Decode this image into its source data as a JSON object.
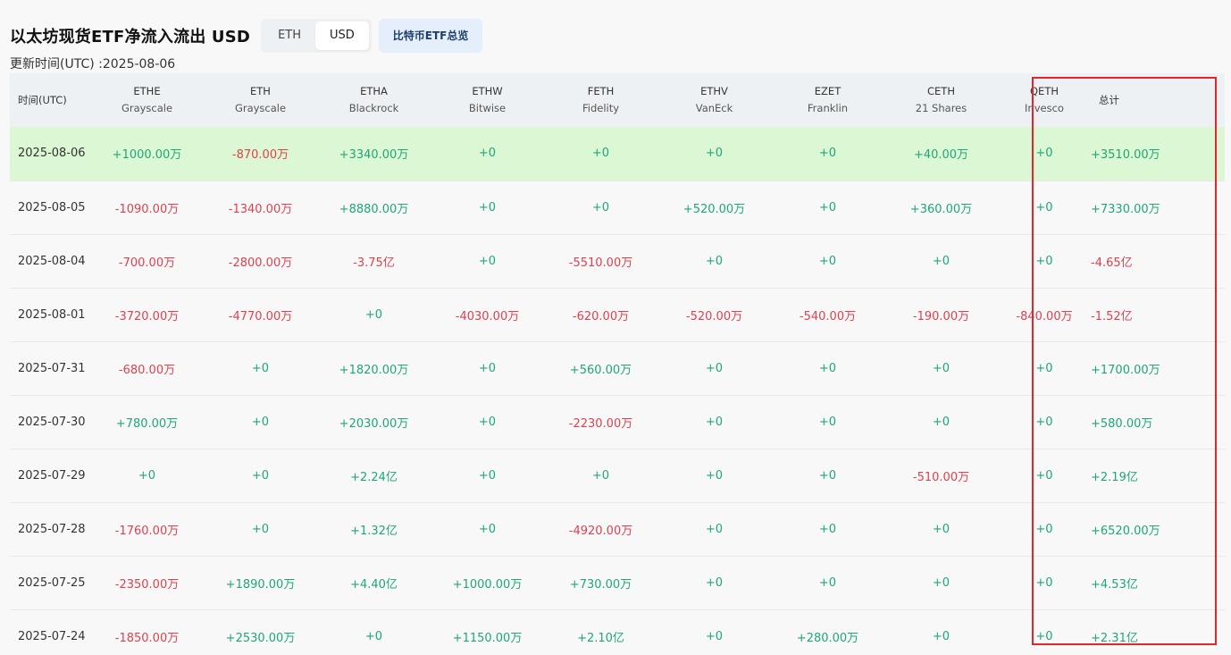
{
  "title": "以太坊现货ETF净流入流出 USD",
  "currency_toggle": {
    "options": [
      "ETH",
      "USD"
    ],
    "selected": "USD"
  },
  "btc_overview_label": "比特币ETF总览",
  "updated": "更新时间(UTC) :2025-08-06",
  "table": {
    "time_header": "时间(UTC)",
    "total_header": "总计",
    "columns": [
      {
        "ticker": "ETHE",
        "fund": "Grayscale"
      },
      {
        "ticker": "ETH",
        "fund": "Grayscale"
      },
      {
        "ticker": "ETHA",
        "fund": "Blackrock"
      },
      {
        "ticker": "ETHW",
        "fund": "Bitwise"
      },
      {
        "ticker": "FETH",
        "fund": "Fidelity"
      },
      {
        "ticker": "ETHV",
        "fund": "VanEck"
      },
      {
        "ticker": "EZET",
        "fund": "Franklin"
      },
      {
        "ticker": "CETH",
        "fund": "21 Shares"
      },
      {
        "ticker": "QETH",
        "fund": "Invesco"
      }
    ],
    "rows": [
      {
        "date": "2025-08-06",
        "highlight": true,
        "values": [
          "+1000.00万",
          "-870.00万",
          "+3340.00万",
          "+0",
          "+0",
          "+0",
          "+0",
          "+40.00万",
          "+0"
        ],
        "total": "+3510.00万"
      },
      {
        "date": "2025-08-05",
        "highlight": false,
        "values": [
          "-1090.00万",
          "-1340.00万",
          "+8880.00万",
          "+0",
          "+0",
          "+520.00万",
          "+0",
          "+360.00万",
          "+0"
        ],
        "total": "+7330.00万"
      },
      {
        "date": "2025-08-04",
        "highlight": false,
        "values": [
          "-700.00万",
          "-2800.00万",
          "-3.75亿",
          "+0",
          "-5510.00万",
          "+0",
          "+0",
          "+0",
          "+0"
        ],
        "total": "-4.65亿"
      },
      {
        "date": "2025-08-01",
        "highlight": false,
        "values": [
          "-3720.00万",
          "-4770.00万",
          "+0",
          "-4030.00万",
          "-620.00万",
          "-520.00万",
          "-540.00万",
          "-190.00万",
          "-840.00万"
        ],
        "total": "-1.52亿"
      },
      {
        "date": "2025-07-31",
        "highlight": false,
        "values": [
          "-680.00万",
          "+0",
          "+1820.00万",
          "+0",
          "+560.00万",
          "+0",
          "+0",
          "+0",
          "+0"
        ],
        "total": "+1700.00万"
      },
      {
        "date": "2025-07-30",
        "highlight": false,
        "values": [
          "+780.00万",
          "+0",
          "+2030.00万",
          "+0",
          "-2230.00万",
          "+0",
          "+0",
          "+0",
          "+0"
        ],
        "total": "+580.00万"
      },
      {
        "date": "2025-07-29",
        "highlight": false,
        "values": [
          "+0",
          "+0",
          "+2.24亿",
          "+0",
          "+0",
          "+0",
          "+0",
          "-510.00万",
          "+0"
        ],
        "total": "+2.19亿"
      },
      {
        "date": "2025-07-28",
        "highlight": false,
        "values": [
          "-1760.00万",
          "+0",
          "+1.32亿",
          "+0",
          "-4920.00万",
          "+0",
          "+0",
          "+0",
          "+0"
        ],
        "total": "+6520.00万"
      },
      {
        "date": "2025-07-25",
        "highlight": false,
        "values": [
          "-2350.00万",
          "+1890.00万",
          "+4.40亿",
          "+1000.00万",
          "+730.00万",
          "+0",
          "+0",
          "+0",
          "+0"
        ],
        "total": "+4.53亿"
      },
      {
        "date": "2025-07-24",
        "highlight": false,
        "values": [
          "-1850.00万",
          "+2530.00万",
          "+0",
          "+1150.00万",
          "+2.10亿",
          "+0",
          "+280.00万",
          "+0",
          "+0"
        ],
        "total": "+2.31亿"
      }
    ]
  },
  "colors": {
    "positive": "#1fa67a",
    "negative": "#e0414f",
    "highlight_row": "#dcf7d3",
    "annotation_box": "#e5242c"
  }
}
